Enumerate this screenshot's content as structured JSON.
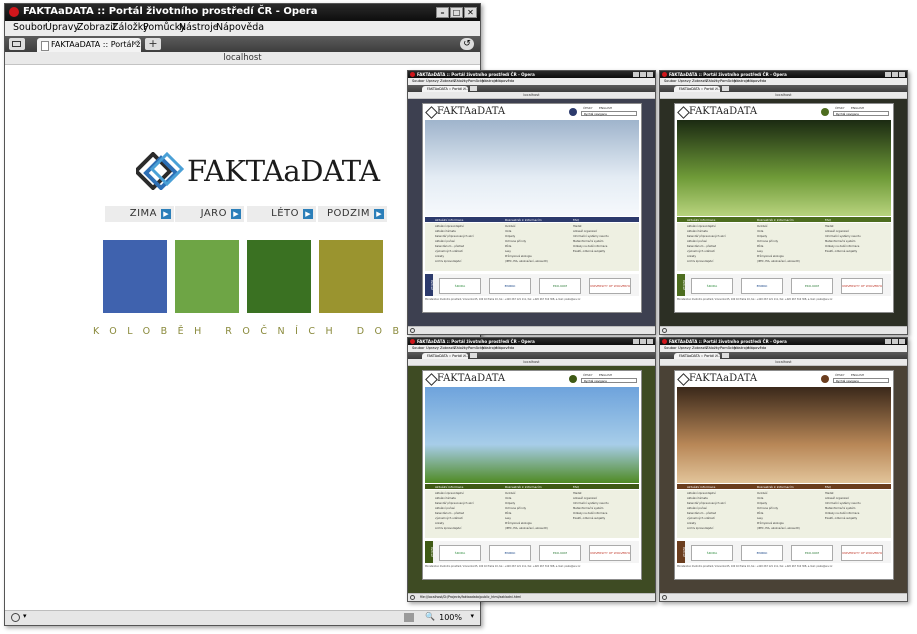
{
  "main_window": {
    "title": "FAKTAaDATA :: Portál životního prostředí ČR - Opera",
    "menu": [
      "Soubor",
      "Úpravy",
      "Zobrazit",
      "Záložky",
      "Pomůcky",
      "Nástroje",
      "Nápověda"
    ],
    "tab_label": "FAKTAaDATA :: Portál ži...",
    "address": "localhost",
    "zoom": "100%",
    "page": {
      "logo_text": "FAKTAaDATA",
      "seasons": [
        "ZIMA",
        "JARO",
        "LÉTO",
        "PODZIM"
      ],
      "season_colors": [
        "#3f62ae",
        "#6ea545",
        "#3a7122",
        "#9a942f"
      ],
      "tagline": "KOLOBĚH ROČNÍCH DOB"
    }
  },
  "thumbnails": [
    {
      "name": "winter",
      "title": "FAKTAaDATA :: Portál životního prostředí ČR - Opera",
      "menu": [
        "Soubor",
        "Úpravy",
        "Zobrazit",
        "Záložky",
        "Pomůcky",
        "Nástroje",
        "Nápověda"
      ],
      "tab_label": "FAKTAaDATA :: Portál ži...",
      "address": "localhost",
      "frame": "#3d4050",
      "accent": "#2c3a6c",
      "hero": [
        "#9fb4cc",
        "#e4ecf4",
        "#f6f9fc"
      ],
      "lang": [
        "ČESKY",
        "ENGLISH"
      ],
      "select": "Rychlá navigace",
      "logo": "FAKTAaDATA",
      "sections": [
        "Aktuální informace",
        "Rozcestník k informacím",
        "FAQ"
      ],
      "col1": [
        "Aktuální zpravodajství",
        "Aktuální témata",
        "Kalendář připravovaných akcí",
        "Aktuální počasí",
        "Kalendárium – přehled",
        "významných událostí",
        "Ankety",
        "Archiv zpravodajství"
      ],
      "col2": [
        "Ovzduší",
        "Voda",
        "Odpady",
        "Ochrana přírody",
        "Půda",
        "Lesy",
        "Průmyslová ekologie",
        "(IPPC, EIA, ekoznačení, ekoaudit)"
      ],
      "col3": [
        "Hledat",
        "Adresář organizací",
        "Informační systémy resortu",
        "Metainformační systém",
        "Odkazy na další informace",
        "Exaktí, odborné subjekty"
      ],
      "partners_label": "Partneři",
      "partners": [
        "ŠKODA",
        "ENIPAK",
        "EKO-KOM",
        "UNIVERSITY OF WOLVERHAMPTON"
      ],
      "footer": "Ministerstvo životního prostředí, Vršovická 65, 100 10 Praha 10, tel.: +420 267 121 111, fax: +420 267 310 308, e-mail: posta@env.cz"
    },
    {
      "name": "spring",
      "title": "FAKTAaDATA :: Portál životního prostředí ČR - Opera",
      "menu": [
        "Soubor",
        "Úpravy",
        "Zobrazit",
        "Záložky",
        "Pomůcky",
        "Nástroje",
        "Nápověda"
      ],
      "tab_label": "FAKTAaDATA :: Portál ži...",
      "address": "localhost",
      "frame": "#2c2f24",
      "accent": "#4d6d1f",
      "hero": [
        "#1b2a12",
        "#6f9b38",
        "#b8d37e"
      ],
      "lang": [
        "ČESKY",
        "ENGLISH"
      ],
      "select": "Rychlá navigace",
      "logo": "FAKTAaDATA",
      "sections": [
        "Aktuální informace",
        "Rozcestník k informacím",
        "FAQ"
      ],
      "col1": [
        "Aktuální zpravodajství",
        "Aktuální témata",
        "Kalendář připravovaných akcí",
        "Aktuální počasí",
        "Kalendárium – přehled",
        "významných událostí",
        "Ankety",
        "Archiv zpravodajství"
      ],
      "col2": [
        "Ovzduší",
        "Voda",
        "Odpady",
        "Ochrana přírody",
        "Půda",
        "Lesy",
        "Průmyslová ekologie",
        "(IPPC, EIA, ekoznačení, ekoaudit)"
      ],
      "col3": [
        "Hledat",
        "Adresář organizací",
        "Informační systémy resortu",
        "Metainformační systém",
        "Odkazy na další informace",
        "Exaktí, odborné subjekty"
      ],
      "partners_label": "Partneři",
      "partners": [
        "ŠKODA",
        "ENIPAK",
        "EKO-KOM",
        "UNIVERSITY OF WOLVERHAMPTON"
      ],
      "footer": "Ministerstvo životního prostředí, Vršovická 65, 100 10 Praha 10, tel.: +420 267 121 111, fax: +420 267 310 308, e-mail: posta@env.cz"
    },
    {
      "name": "summer",
      "title": "FAKTAaDATA :: Portál životního prostředí ČR - Opera",
      "menu": [
        "Soubor",
        "Úpravy",
        "Zobrazit",
        "Záložky",
        "Pomůcky",
        "Nástroje",
        "Nápověda"
      ],
      "tab_label": "FAKTAaDATA :: Portál ži...",
      "address": "localhost",
      "frame": "#3e4b23",
      "accent": "#3f5a15",
      "hero": [
        "#6ea3dc",
        "#a7cde9",
        "#4f8a23"
      ],
      "lang": [
        "ČESKY",
        "ENGLISH"
      ],
      "select": "Rychlá navigace",
      "logo": "FAKTAaDATA",
      "sections": [
        "Aktuální informace",
        "Rozcestník k informacím",
        "FAQ"
      ],
      "col1": [
        "Aktuální zpravodajství",
        "Aktuální témata",
        "Kalendář připravovaných akcí",
        "Aktuální počasí",
        "Kalendárium – přehled",
        "významných událostí",
        "Ankety",
        "Archiv zpravodajství"
      ],
      "col2": [
        "Ovzduší",
        "Voda",
        "Odpady",
        "Ochrana přírody",
        "Půda",
        "Lesy",
        "Průmyslová ekologie",
        "(IPPC, EIA, ekoznačení, ekoaudit)"
      ],
      "col3": [
        "Hledat",
        "Adresář organizací",
        "Informační systémy resortu",
        "Metainformační systém",
        "Odkazy na další informace",
        "Exaktí, odborné subjekty"
      ],
      "partners_label": "Partneři",
      "partners": [
        "ŠKODA",
        "ENIPAK",
        "EKO-KOM",
        "UNIVERSITY OF WOLVERHAMPTON"
      ],
      "footer": "Ministerstvo životního prostředí, Vršovická 65, 100 10 Praha 10, tel.: +420 267 121 111, fax: +420 267 310 308, e-mail: posta@env.cz",
      "status": "file://localhost/D:/Projects/faktaadata/public_html/zakladni.html"
    },
    {
      "name": "autumn",
      "title": "FAKTAaDATA :: Portál životního prostředí ČR - Opera",
      "menu": [
        "Soubor",
        "Úpravy",
        "Zobrazit",
        "Záložky",
        "Pomůcky",
        "Nástroje",
        "Nápověda"
      ],
      "tab_label": "FAKTAaDATA :: Portál ži...",
      "address": "localhost",
      "frame": "#4a4236",
      "accent": "#6b3d1e",
      "hero": [
        "#3a281a",
        "#b88757",
        "#e2c49a"
      ],
      "lang": [
        "ČESKY",
        "ENGLISH"
      ],
      "select": "Rychlá navigace",
      "logo": "FAKTAaDATA",
      "sections": [
        "Aktuální informace",
        "Rozcestník k informacím",
        "FAQ"
      ],
      "col1": [
        "Aktuální zpravodajství",
        "Aktuální témata",
        "Kalendář připravovaných akcí",
        "Aktuální počasí",
        "Kalendárium – přehled",
        "významných událostí",
        "Ankety",
        "Archiv zpravodajství"
      ],
      "col2": [
        "Ovzduší",
        "Voda",
        "Odpady",
        "Ochrana přírody",
        "Půda",
        "Lesy",
        "Průmyslová ekologie",
        "(IPPC, EIA, ekoznačení, ekoaudit)"
      ],
      "col3": [
        "Hledat",
        "Adresář organizací",
        "Informační systémy resortu",
        "Metainformační systém",
        "Odkazy na další informace",
        "Exaktí, odborné subjekty"
      ],
      "partners_label": "Partneři",
      "partners": [
        "ŠKODA",
        "ENIPAK",
        "EKO-KOM",
        "UNIVERSITY OF WOLVERHAMPTON"
      ],
      "footer": "Ministerstvo životního prostředí, Vršovická 65, 100 10 Praha 10, tel.: +420 267 121 111, fax: +420 267 310 308, e-mail: posta@env.cz"
    }
  ]
}
